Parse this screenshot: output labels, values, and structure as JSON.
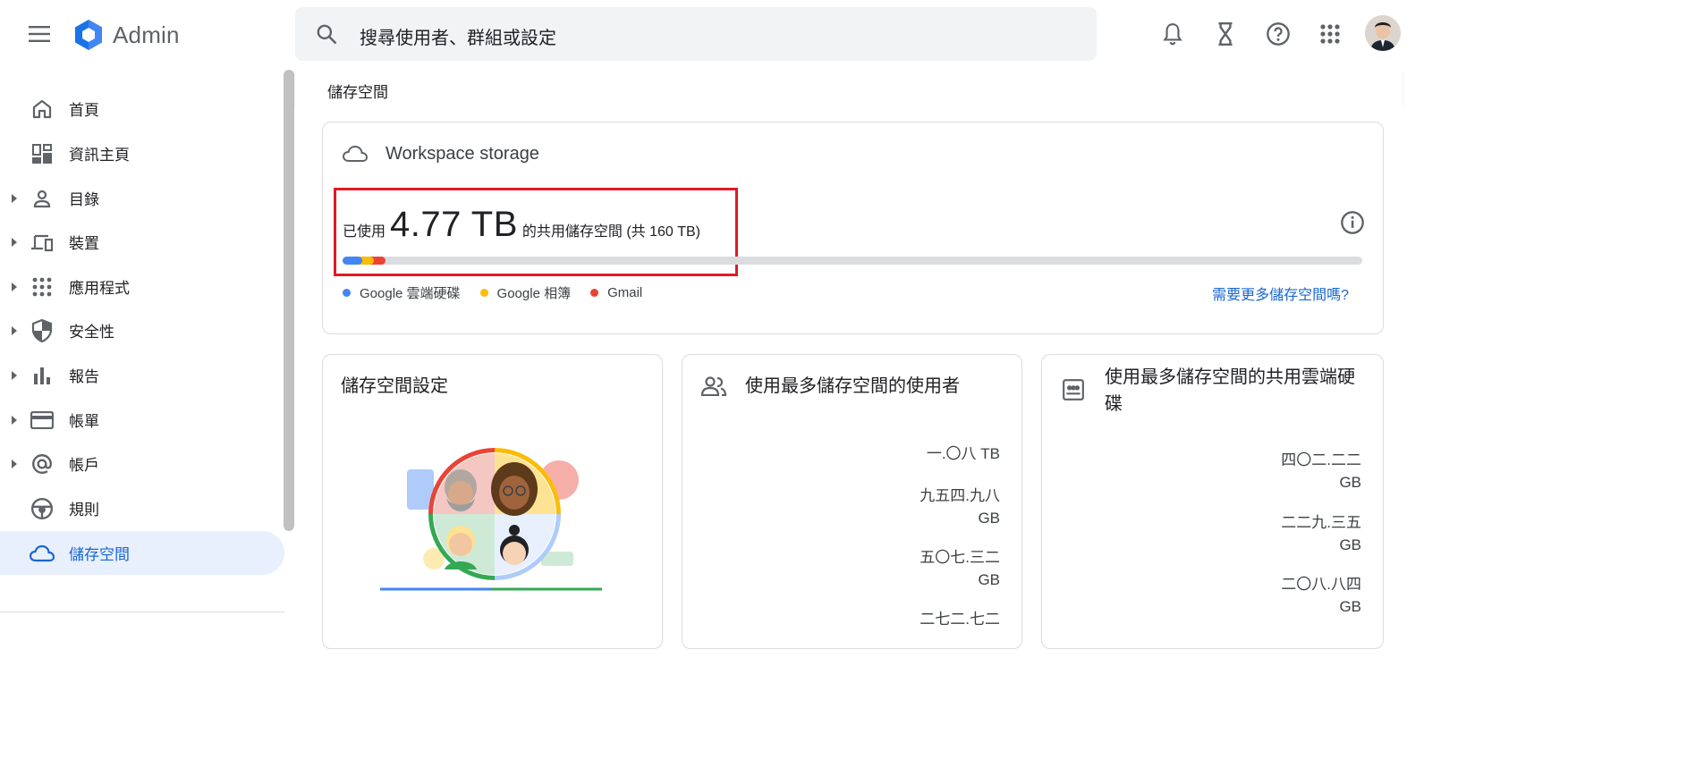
{
  "app": {
    "name": "Admin",
    "logo_icon": "admin-hexagon-logo"
  },
  "topbar": {
    "menu_icon": "hamburger-menu-icon",
    "search_placeholder": "搜尋使用者、群組或設定",
    "icons": [
      "bell-icon",
      "hourglass-icon",
      "help-icon",
      "apps-grid-icon"
    ],
    "avatar": "user-avatar"
  },
  "sidebar": {
    "items": [
      {
        "label": "首頁",
        "icon": "home-icon",
        "expandable": false,
        "active": false
      },
      {
        "label": "資訊主頁",
        "icon": "dashboard-icon",
        "expandable": false,
        "active": false
      },
      {
        "label": "目錄",
        "icon": "person-icon",
        "expandable": true,
        "active": false
      },
      {
        "label": "裝置",
        "icon": "devices-icon",
        "expandable": true,
        "active": false
      },
      {
        "label": "應用程式",
        "icon": "apps-icon",
        "expandable": true,
        "active": false
      },
      {
        "label": "安全性",
        "icon": "shield-icon",
        "expandable": true,
        "active": false
      },
      {
        "label": "報告",
        "icon": "bar-chart-icon",
        "expandable": true,
        "active": false
      },
      {
        "label": "帳單",
        "icon": "credit-card-icon",
        "expandable": true,
        "active": false
      },
      {
        "label": "帳戶",
        "icon": "at-sign-icon",
        "expandable": true,
        "active": false
      },
      {
        "label": "規則",
        "icon": "rules-icon",
        "expandable": false,
        "active": false
      },
      {
        "label": "儲存空間",
        "icon": "cloud-icon",
        "expandable": false,
        "active": true
      }
    ]
  },
  "breadcrumb": {
    "current": "儲存空間"
  },
  "workspace_storage": {
    "title": "Workspace storage",
    "used_prefix": "已使用",
    "used_value": "4.77 TB",
    "used_suffix": "的共用儲存空間 (共 160 TB)",
    "usage_fraction": 0.0298,
    "segments": [
      {
        "name": "Google 雲端硬碟",
        "color": "#4285f4",
        "fraction": 0.019
      },
      {
        "name": "Google 相簿",
        "color": "#fbbc04",
        "fraction": 0.012
      },
      {
        "name": "Gmail",
        "color": "#ea4335",
        "fraction": 0.011
      }
    ],
    "more_storage_link": "需要更多儲存空間嗎?"
  },
  "cards": {
    "settings": {
      "title": "儲存空間設定"
    },
    "top_users": {
      "title": "使用最多儲存空間的使用者",
      "icon": "people-icon",
      "values": [
        "一.〇八 TB",
        "九五四.九八\nGB",
        "五〇七.三二\nGB",
        "二七二.七二"
      ]
    },
    "top_shared_drives": {
      "title": "使用最多儲存空間的共用雲端硬碟",
      "icon": "shared-drive-icon",
      "values": [
        "四〇二.二二\nGB",
        "二二九.三五\nGB",
        "二〇八.八四\nGB"
      ]
    }
  }
}
